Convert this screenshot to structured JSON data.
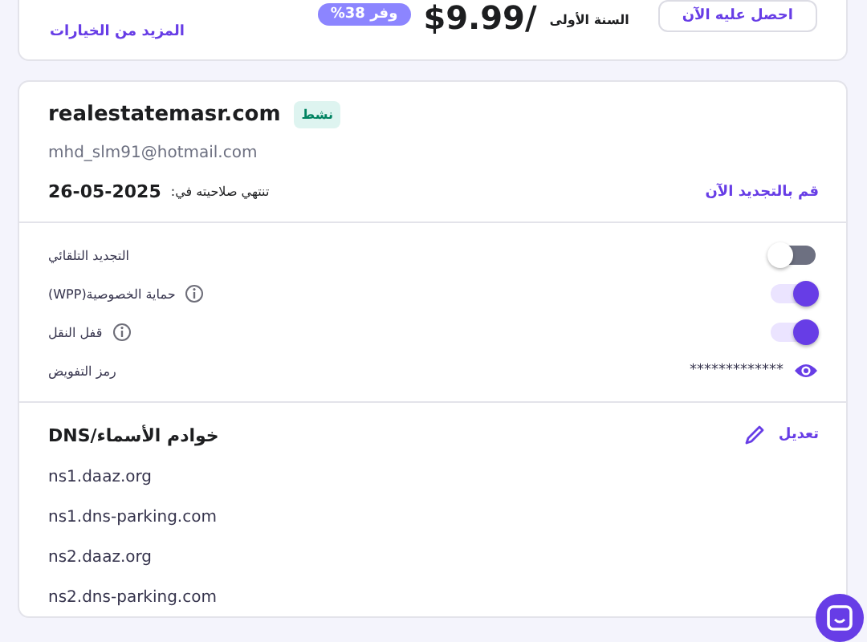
{
  "offer": {
    "more_options": "المزيد من الخيارات",
    "discount_badge": "وفر 38%",
    "price": "$9.99/",
    "period": "السنة الأولى",
    "button": "احصل عليه الآن"
  },
  "domain": {
    "name": "realestatemasr.com",
    "status": "نشط",
    "email": "mhd_slm91@hotmail.com",
    "expiry_label": "تنتهي صلاحيته في:",
    "expiry_date": "26-05-2025",
    "renew_link": "قم بالتجديد الآن"
  },
  "settings": [
    {
      "kind": "toggle",
      "label": "التجديد التلقائي",
      "info": false,
      "on": false
    },
    {
      "kind": "toggle",
      "label": "حماية الخصوصية(WPP)",
      "info": true,
      "on": true
    },
    {
      "kind": "toggle",
      "label": "قفل النقل",
      "info": true,
      "on": true
    },
    {
      "kind": "secret",
      "label": "رمز التفويض",
      "value": "*************"
    }
  ],
  "nameservers": {
    "title": "خوادم الأسماء/DNS",
    "edit": "تعديل",
    "items": [
      "ns1.daaz.org",
      "ns1.dns-parking.com",
      "ns2.daaz.org",
      "ns2.dns-parking.com"
    ]
  }
}
